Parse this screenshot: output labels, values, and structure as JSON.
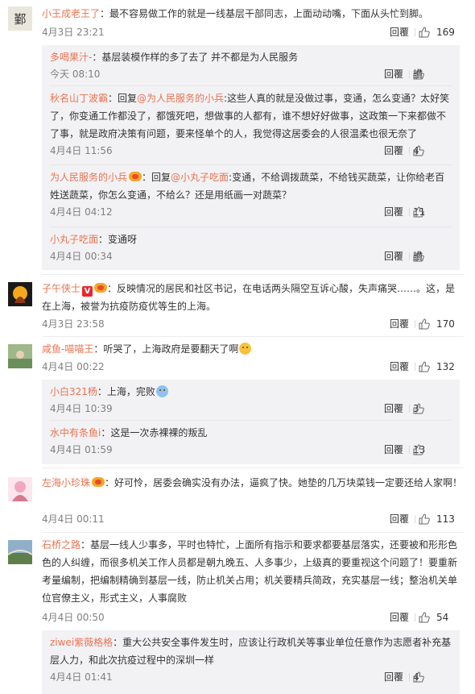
{
  "comments": [
    {
      "user": "小王成老王了",
      "text": "：最不容易做工作的就是一线基层干部同志，上面动动嘴，下面从头忙到脚。",
      "time": "4月3日 23:21",
      "reply": "回覆",
      "likes": "169",
      "subs": [
        {
          "user": "多喝果汁-",
          "text": "：基层装模作样的多了去了 并不都是为人民服务",
          "time": "今天 08:10",
          "reply": "回覆",
          "likes": "讃"
        },
        {
          "user": "秋名山丁波霸",
          "pre": "：回复",
          "at": "@为人民服务的小兵",
          "text": ":这些人真的就是没做过事，变通，怎么变通？太好笑了，你变通工作都没了，都饿死吧，想做事的人都有，谁不想好好做事，这政策一下来都做不了事，就是政府决策有问题，要来怪单个的人，我觉得这居委会的人很温柔也很无奈了",
          "time": "4月4日 11:56",
          "reply": "回覆",
          "likes": "4"
        },
        {
          "user": "为人民服务的小兵",
          "pre": "：回复",
          "at": "@小丸子吃面",
          "text": ":变通，不给调拨蔬菜，不给钱买蔬菜，让你给老百姓送蔬菜，你怎么变通，不给么？还是用纸画一对蔬菜？",
          "time": "4月4日 04:12",
          "reply": "回覆",
          "likes": "11"
        },
        {
          "user": "小丸子吃面",
          "text": "：变通呀",
          "time": "4月4日 00:34",
          "reply": "回覆",
          "likes": "讃"
        }
      ]
    },
    {
      "user": "子午侠士",
      "text": "：反映情况的居民和社区书记，在电话两头隔空互诉心酸，失声痛哭……。这，是在上海，被誉为抗疫防疫优等生的上海。",
      "time": "4月3日 23:58",
      "reply": "回覆",
      "likes": "170"
    },
    {
      "user": "咸鱼-喵喵王",
      "text": "：听哭了，上海政府是要翻天了啊",
      "time": "4月4日 00:22",
      "reply": "回覆",
      "likes": "132",
      "subs": [
        {
          "user": "小白321杨",
          "text": "：上海，完败",
          "time": "4月4日 10:39",
          "reply": "回覆",
          "likes": "3"
        },
        {
          "user": "水中有条鱼i",
          "text": "：这是一次赤裸裸的叛乱",
          "time": "4月4日 01:59",
          "reply": "回覆",
          "likes": "13"
        }
      ]
    },
    {
      "user": "左海小珍珠",
      "text": "：好可怜，居委会确实没有办法，逼疯了快。她垫的几万块菜钱一定要还给人家啊！",
      "time": "4月4日 00:11",
      "reply": "回覆",
      "likes": "113"
    },
    {
      "user": "石桥之路",
      "text": "：基层一线人少事多，平时也特忙，上面所有指示和要求都要基层落实，还要被和形形色色的人纠缠，而很多机关工作人员都是朝九晚五、人多事少，上级真的要重视这个问题了！要重新考量编制，把编制精确到基层一线，防止机关占用；机关要精兵简政，充实基层一线；整治机关单位官僚主义，形式主义，人事腐败",
      "time": "4月4日 00:50",
      "reply": "回覆",
      "likes": "54",
      "subs": [
        {
          "user": "ziwei紫薇格格",
          "text": "：重大公共安全事件发生时，应该让行政机关等事业单位任意作为志愿者补充基层人力，和此次抗疫过程中的深圳一样",
          "time": "4月4日 01:41",
          "reply": "回覆",
          "likes": "4"
        }
      ]
    }
  ],
  "icons": {
    "like": "thumbs-up-icon"
  },
  "colors": {
    "username": "#eb7350",
    "reply_bg": "#f2f2f5",
    "meta": "#808080"
  }
}
